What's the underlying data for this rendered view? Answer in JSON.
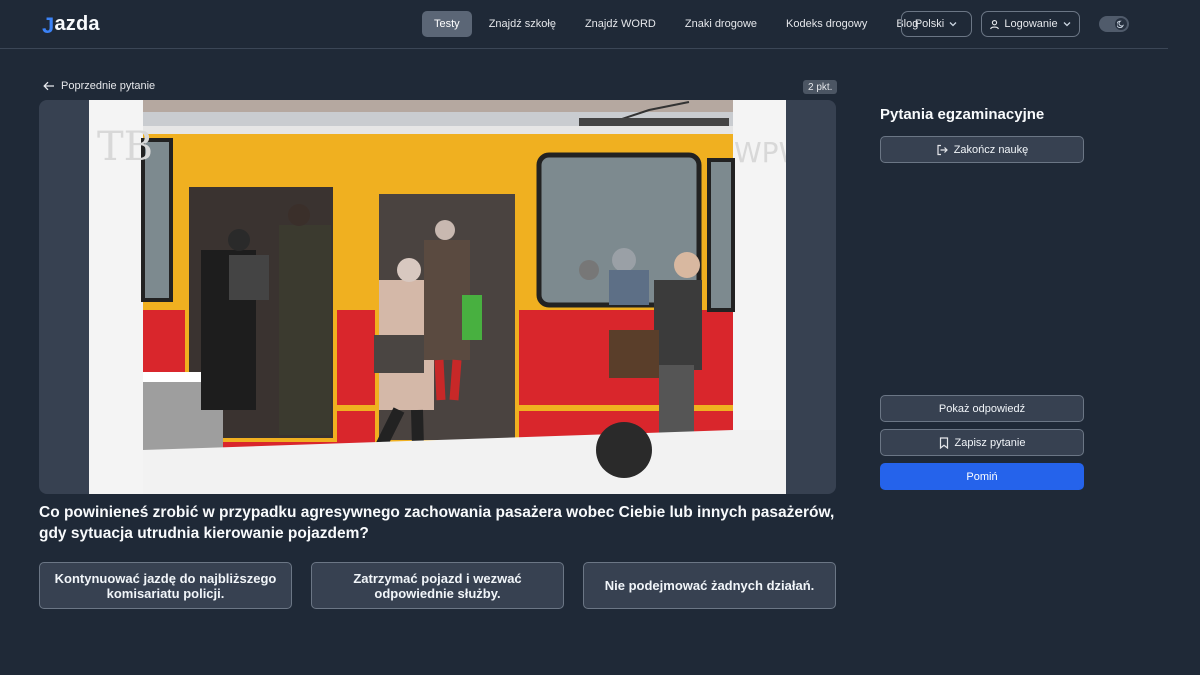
{
  "header": {
    "logo_mark": "J",
    "logo_text": "azda",
    "nav": [
      {
        "label": "Testy",
        "active": true
      },
      {
        "label": "Znajdź szkołę",
        "active": false
      },
      {
        "label": "Znajdź WORD",
        "active": false
      },
      {
        "label": "Znaki drogowe",
        "active": false
      },
      {
        "label": "Kodeks drogowy",
        "active": false
      },
      {
        "label": "Blog",
        "active": false
      }
    ],
    "language": "Polski",
    "login": "Logowanie",
    "icons": {
      "chevron": "chevron-down-icon",
      "user": "user-icon",
      "theme": "moon-icon"
    }
  },
  "main": {
    "prev_link": "Poprzednie pytanie",
    "points": "2 pkt.",
    "image_watermark_left": "TB",
    "image_watermark_right": "WPW",
    "question": "Co powinieneś zrobić w przypadku agresywnego zachowania pasażera wobec Ciebie lub innych pasażerów, gdy sytuacja utrudnia kierowanie pojazdem?",
    "answers": [
      "Kontynuować jazdę do najbliższego komisariatu policji.",
      "Zatrzymać pojazd i wezwać odpowiednie służby.",
      "Nie podejmować żadnych działań."
    ]
  },
  "sidebar": {
    "title": "Pytania egzaminacyjne",
    "end_learning": "Zakończ naukę",
    "show_answer": "Pokaż odpowiedź",
    "save_question": "Zapisz pytanie",
    "skip": "Pomiń"
  },
  "colors": {
    "background": "#1f2937",
    "panel": "#374151",
    "accent": "#2563eb",
    "logo_accent": "#3b82f6"
  }
}
